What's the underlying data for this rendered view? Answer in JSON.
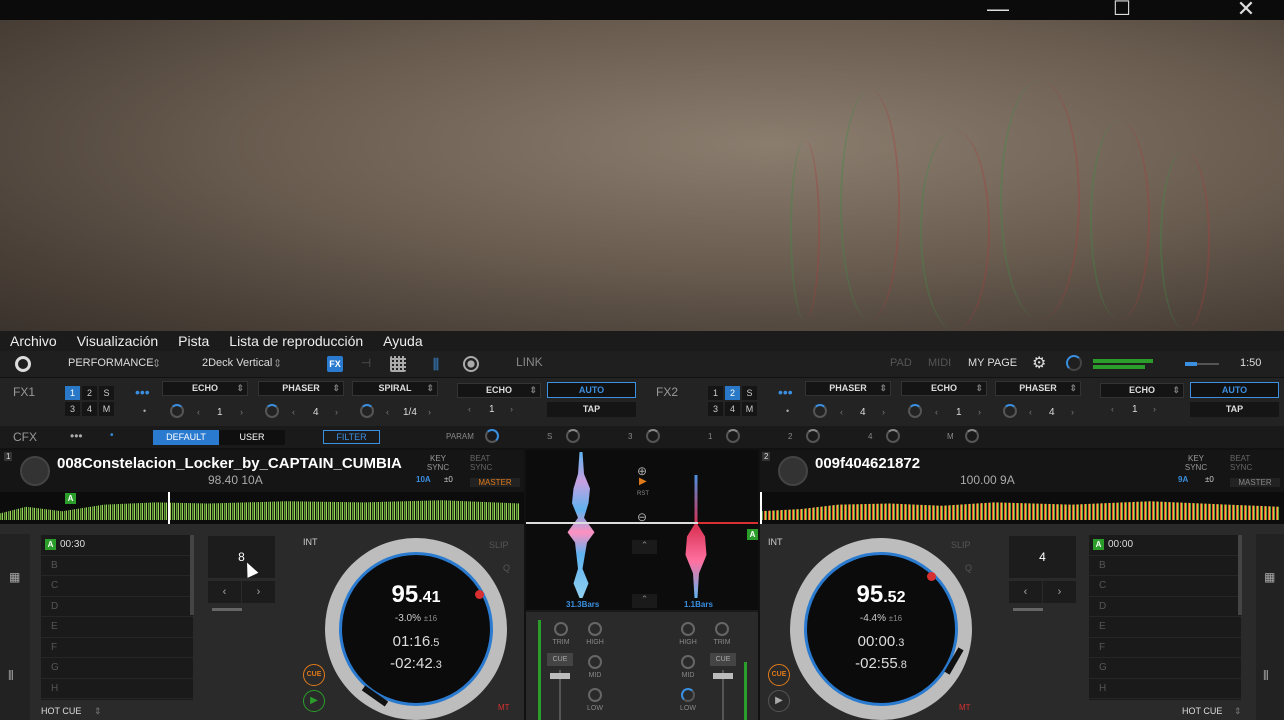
{
  "window": {
    "minimize": "—",
    "maximize": "☐",
    "close": "✕"
  },
  "menu": [
    "Archivo",
    "Visualización",
    "Pista",
    "Lista de reproducción",
    "Ayuda"
  ],
  "toolbar": {
    "mode": "PERFORMANCE",
    "layout": "2Deck Vertical",
    "link": "LINK",
    "pad": "PAD",
    "midi": "MIDI",
    "mypage": "MY PAGE",
    "time": "1:50"
  },
  "fx1": {
    "label": "FX1",
    "grid": [
      "1",
      "2",
      "S",
      "3",
      "4",
      "M"
    ],
    "slots": [
      {
        "name": "ECHO",
        "value": "1"
      },
      {
        "name": "PHASER",
        "value": "4"
      },
      {
        "name": "SPIRAL",
        "value": "1/4"
      }
    ],
    "beat": {
      "name": "ECHO",
      "value": "1"
    },
    "auto": "AUTO",
    "tap": "TAP"
  },
  "fx2": {
    "label": "FX2",
    "grid": [
      "1",
      "2",
      "S",
      "3",
      "4",
      "M"
    ],
    "slots": [
      {
        "name": "PHASER",
        "value": "4"
      },
      {
        "name": "ECHO",
        "value": "1"
      },
      {
        "name": "PHASER",
        "value": "4"
      }
    ],
    "beat": {
      "name": "ECHO",
      "value": "1"
    },
    "auto": "AUTO",
    "tap": "TAP"
  },
  "cfx": {
    "label": "CFX",
    "default": "DEFAULT",
    "user": "USER",
    "filter": "FILTER",
    "param": "PARAM",
    "knobs": [
      "S",
      "3",
      "1",
      "2",
      "4",
      "M"
    ]
  },
  "deck1": {
    "num": "1",
    "title": "008Constelacion_Locker_by_CAPTAIN_CUMBIA",
    "bpm_key": "98.40  10A",
    "key_sync": "KEY SYNC",
    "key": "10A",
    "key_adj": "±0",
    "beat_sync": "BEAT SYNC",
    "master": "MASTER",
    "cue_a_time": "00:30",
    "cues": [
      "B",
      "C",
      "D",
      "E",
      "F",
      "G",
      "H"
    ],
    "loop": "8",
    "int": "INT",
    "slip": "SLIP",
    "q": "Q",
    "bpm_int": "95",
    "bpm_dec": ".41",
    "pitch": "-3.0%",
    "range": "±16",
    "elapsed_main": "01:16",
    "elapsed_frac": ".5",
    "remain_main": "-02:42",
    "remain_frac": ".3",
    "cue": "CUE",
    "mt": "MT",
    "hotcue": "HOT CUE",
    "marker": "A"
  },
  "deck2": {
    "num": "2",
    "title": "009f404621872",
    "bpm_key": "100.00  9A",
    "key_sync": "KEY SYNC",
    "key": "9A",
    "key_adj": "±0",
    "beat_sync": "BEAT SYNC",
    "master": "MASTER",
    "cue_a_time": "00:00",
    "cues": [
      "B",
      "C",
      "D",
      "E",
      "F",
      "G",
      "H"
    ],
    "loop": "4",
    "int": "INT",
    "slip": "SLIP",
    "q": "Q",
    "bpm_int": "95",
    "bpm_dec": ".52",
    "pitch": "-4.4%",
    "range": "±16",
    "elapsed_main": "00:00",
    "elapsed_frac": ".3",
    "remain_main": "-02:55",
    "remain_frac": ".8",
    "cue": "CUE",
    "mt": "MT",
    "hotcue": "HOT CUE",
    "marker": "A"
  },
  "mixer": {
    "bars_left": "31.3Bars",
    "bars_right": "1.1Bars",
    "rst": "RST",
    "trim": "TRIM",
    "high": "HIGH",
    "mid": "MID",
    "low": "LOW",
    "cue": "CUE",
    "marker": "A"
  },
  "colors": {
    "accent": "#2a7bd0",
    "green": "#2a9d2a",
    "orange": "#e07a1a",
    "red": "#d83030"
  }
}
